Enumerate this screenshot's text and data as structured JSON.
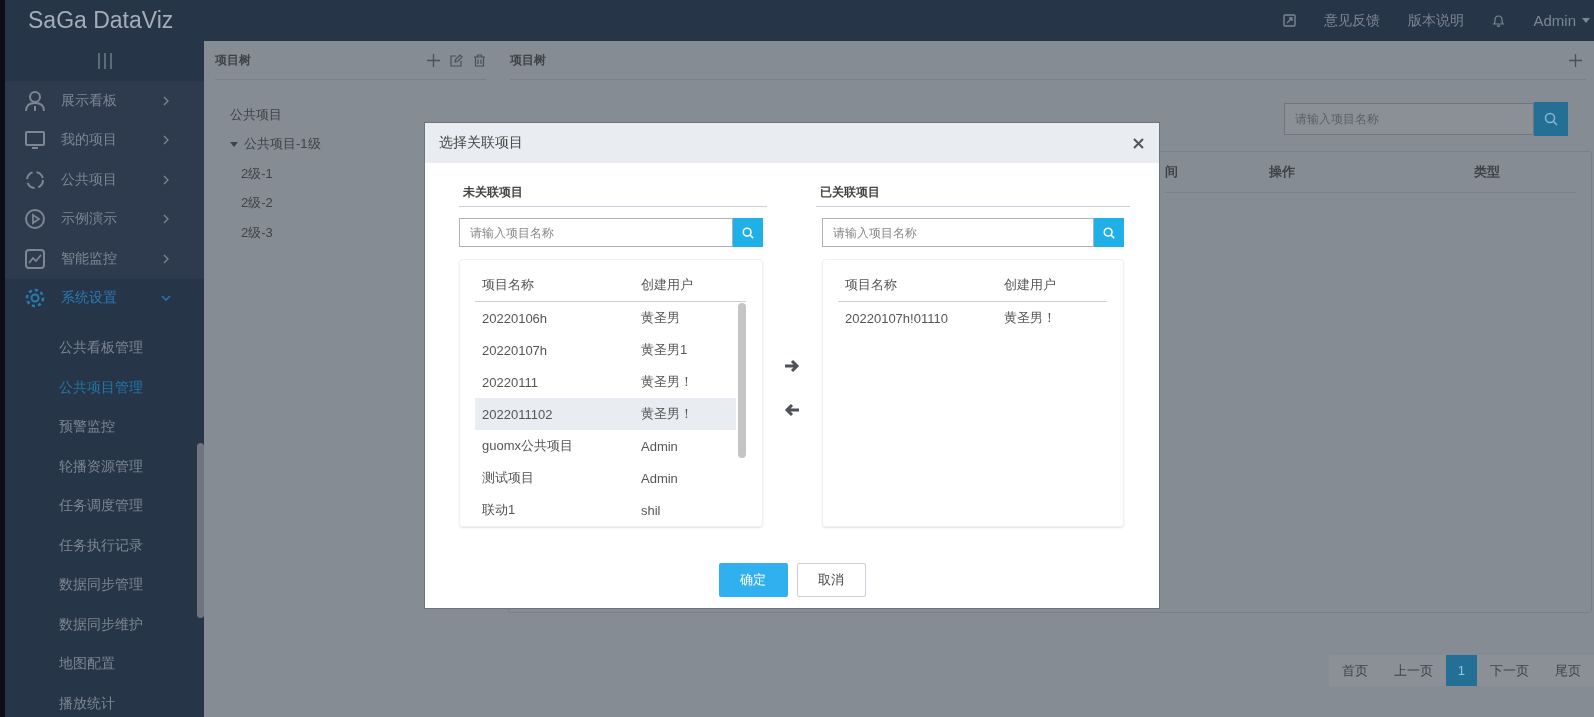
{
  "header": {
    "logo": "SaGa DataViz",
    "links": [
      "意见反馈",
      "版本说明"
    ],
    "user": "Admin"
  },
  "sidebar": {
    "items": [
      {
        "label": "展示看板",
        "expanded": false
      },
      {
        "label": "我的项目",
        "expanded": false
      },
      {
        "label": "公共项目",
        "expanded": false
      },
      {
        "label": "示例演示",
        "expanded": false
      },
      {
        "label": "智能监控",
        "expanded": false
      },
      {
        "label": "系统设置",
        "expanded": true,
        "children": [
          {
            "label": "公共看板管理",
            "selected": false
          },
          {
            "label": "公共项目管理",
            "selected": true
          },
          {
            "label": "预警监控",
            "selected": false
          },
          {
            "label": "轮播资源管理",
            "selected": false
          },
          {
            "label": "任务调度管理",
            "selected": false
          },
          {
            "label": "任务执行记录",
            "selected": false
          },
          {
            "label": "数据同步管理",
            "selected": false
          },
          {
            "label": "数据同步维护",
            "selected": false
          },
          {
            "label": "地图配置",
            "selected": false
          },
          {
            "label": "播放统计",
            "selected": false
          }
        ]
      }
    ]
  },
  "tree_panel": {
    "title": "项目树",
    "tree": [
      {
        "label": "公共项目"
      },
      {
        "label": "公共项目-1级",
        "expanded": true,
        "children": [
          {
            "label": "2级-1"
          },
          {
            "label": "2级-2"
          },
          {
            "label": "2级-3"
          }
        ]
      }
    ]
  },
  "main_panel": {
    "title": "项目树",
    "search": {
      "placeholder": "请输入项目名称"
    },
    "columns": [
      "间",
      "操作",
      "类型"
    ],
    "pagination": [
      {
        "label": "首页",
        "selected": false
      },
      {
        "label": "上一页",
        "selected": false
      },
      {
        "label": "1",
        "selected": true
      },
      {
        "label": "下一页",
        "selected": false
      },
      {
        "label": "尾页",
        "selected": false
      }
    ]
  },
  "dialog": {
    "title": "选择关联项目",
    "lists": [
      {
        "title": "未关联项目",
        "search": {
          "placeholder": "请输入项目名称"
        },
        "columns": [
          "项目名称",
          "创建用户"
        ],
        "rows": [
          {
            "name": "20220106h",
            "user": "黄圣男",
            "selected": false
          },
          {
            "name": "20220107h",
            "user": "黄圣男1",
            "selected": false
          },
          {
            "name": "20220111",
            "user": "黄圣男！",
            "selected": false
          },
          {
            "name": "2022011102",
            "user": "黄圣男！",
            "selected": true
          },
          {
            "name": "guomx公共项目",
            "user": "Admin",
            "selected": false
          },
          {
            "name": "测试项目",
            "user": "Admin",
            "selected": false
          },
          {
            "name": "联动1",
            "user": "shil",
            "selected": false
          }
        ]
      },
      {
        "title": "已关联项目",
        "search": {
          "placeholder": "请输入项目名称"
        },
        "columns": [
          "项目名称",
          "创建用户"
        ],
        "rows": [
          {
            "name": "20220107h!01110",
            "user": "黄圣男！",
            "selected": false
          }
        ]
      }
    ],
    "buttons": [
      {
        "label": "确定",
        "kind": "primary"
      },
      {
        "label": "取消",
        "kind": "secondary"
      }
    ]
  }
}
